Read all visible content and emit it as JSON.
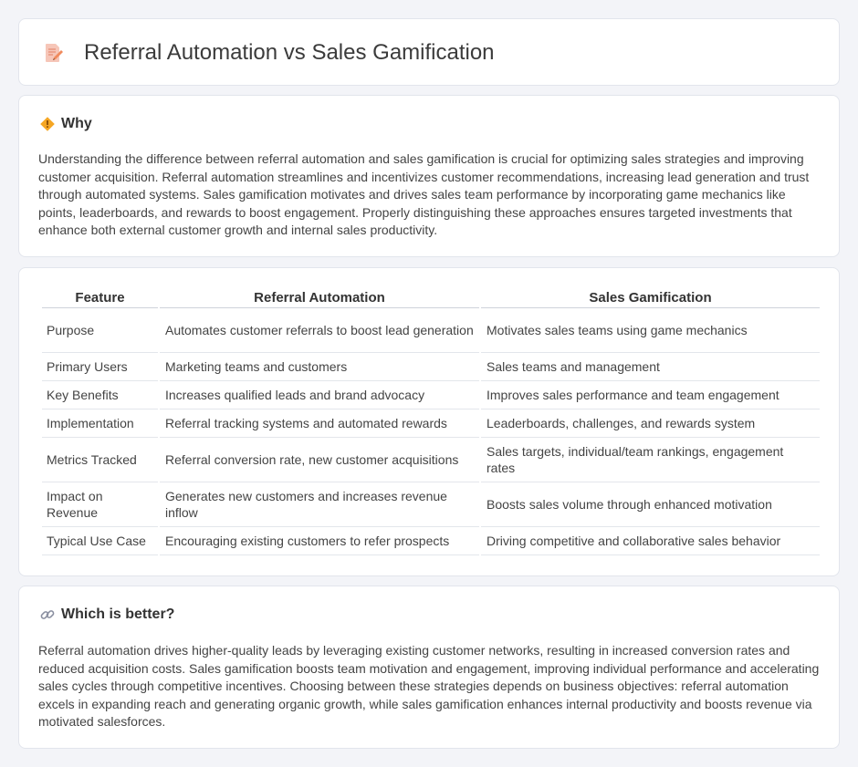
{
  "header": {
    "title": "Referral Automation vs Sales Gamification",
    "icon": "document-pen-icon"
  },
  "why": {
    "title": "Why",
    "icon": "diamond-warning-icon",
    "text": "Understanding the difference between referral automation and sales gamification is crucial for optimizing sales strategies and improving customer acquisition. Referral automation streamlines and incentivizes customer recommendations, increasing lead generation and trust through automated systems. Sales gamification motivates and drives sales team performance by incorporating game mechanics like points, leaderboards, and rewards to boost engagement. Properly distinguishing these approaches ensures targeted investments that enhance both external customer growth and internal sales productivity."
  },
  "table": {
    "headers": [
      "Feature",
      "Referral Automation",
      "Sales Gamification"
    ],
    "rows": [
      [
        "Purpose",
        "Automates customer referrals to boost lead generation",
        "Motivates sales teams using game mechanics"
      ],
      [
        "Primary Users",
        "Marketing teams and customers",
        "Sales teams and management"
      ],
      [
        "Key Benefits",
        "Increases qualified leads and brand advocacy",
        "Improves sales performance and team engagement"
      ],
      [
        "Implementation",
        "Referral tracking systems and automated rewards",
        "Leaderboards, challenges, and rewards system"
      ],
      [
        "Metrics Tracked",
        "Referral conversion rate, new customer acquisitions",
        "Sales targets, individual/team rankings, engagement rates"
      ],
      [
        "Impact on Revenue",
        "Generates new customers and increases revenue inflow",
        "Boosts sales volume through enhanced motivation"
      ],
      [
        "Typical Use Case",
        "Encouraging existing customers to refer prospects",
        "Driving competitive and collaborative sales behavior"
      ]
    ]
  },
  "better": {
    "title": "Which is better?",
    "icon": "link-icon",
    "text": "Referral automation drives higher-quality leads by leveraging existing customer networks, resulting in increased conversion rates and reduced acquisition costs. Sales gamification boosts team motivation and engagement, improving individual performance and accelerating sales cycles through competitive incentives. Choosing between these strategies depends on business objectives: referral automation excels in expanding reach and generating organic growth, while sales gamification enhances internal productivity and boosts revenue via motivated salesforces."
  }
}
